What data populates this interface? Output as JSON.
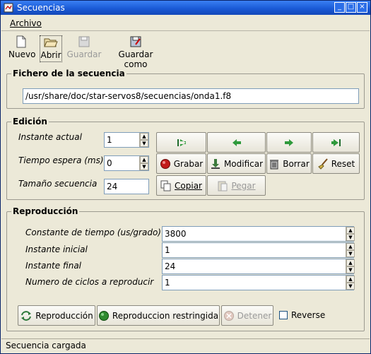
{
  "window": {
    "title": "Secuencias",
    "controls": [
      "minimize",
      "maximize",
      "close"
    ]
  },
  "menu": {
    "items": [
      {
        "label": "Archivo"
      }
    ]
  },
  "toolbar": {
    "buttons": [
      {
        "label": "Nuevo",
        "icon": "new-file-icon",
        "state": "enabled"
      },
      {
        "label": "Abrir",
        "icon": "open-folder-icon",
        "state": "selected"
      },
      {
        "label": "Guardar",
        "icon": "save-disk-icon",
        "state": "disabled"
      },
      {
        "label": "Guardar como",
        "icon": "save-as-icon",
        "state": "enabled"
      }
    ]
  },
  "fichero": {
    "title": "Fichero de la secuencia",
    "path": "/usr/share/doc/star-servos8/secuencias/onda1.f8"
  },
  "edicion": {
    "title": "Edición",
    "fields": [
      {
        "label": "Instante actual",
        "value": "1",
        "spinner": true
      },
      {
        "label": "Tiempo espera (ms)",
        "value": "0",
        "spinner": true
      },
      {
        "label": "Tamaño secuencia",
        "value": "24",
        "spinner": false
      }
    ],
    "nav_buttons": [
      "first-icon",
      "prev-arrow-icon",
      "next-arrow-icon",
      "last-icon"
    ],
    "action_buttons": [
      {
        "label": "Grabar",
        "icon": "record-icon"
      },
      {
        "label": "Modificar",
        "icon": "modify-icon"
      },
      {
        "label": "Borrar",
        "icon": "trash-icon"
      },
      {
        "label": "Reset",
        "icon": "broom-icon"
      }
    ],
    "clipboard_buttons": [
      {
        "label": "Copiar",
        "icon": "copy-icon",
        "state": "enabled"
      },
      {
        "label": "Pegar",
        "icon": "paste-icon",
        "state": "disabled"
      }
    ]
  },
  "reproduccion": {
    "title": "Reproducción",
    "fields": [
      {
        "label": "Constante de tiempo (us/grado)",
        "value": "3800"
      },
      {
        "label": "Instante inicial",
        "value": "1"
      },
      {
        "label": "Instante final",
        "value": "24"
      },
      {
        "label": "Numero de ciclos a reproducir",
        "value": "1"
      }
    ],
    "buttons": [
      {
        "label": "Reproducción",
        "icon": "cycle-icon",
        "state": "enabled"
      },
      {
        "label": "Reproduccion restringida",
        "icon": "green-ball-icon",
        "state": "enabled"
      },
      {
        "label": "Detener",
        "icon": "stop-icon",
        "state": "disabled"
      }
    ],
    "reverse": {
      "label": "Reverse",
      "checked": false
    }
  },
  "status": {
    "text": "Secuencia cargada"
  }
}
